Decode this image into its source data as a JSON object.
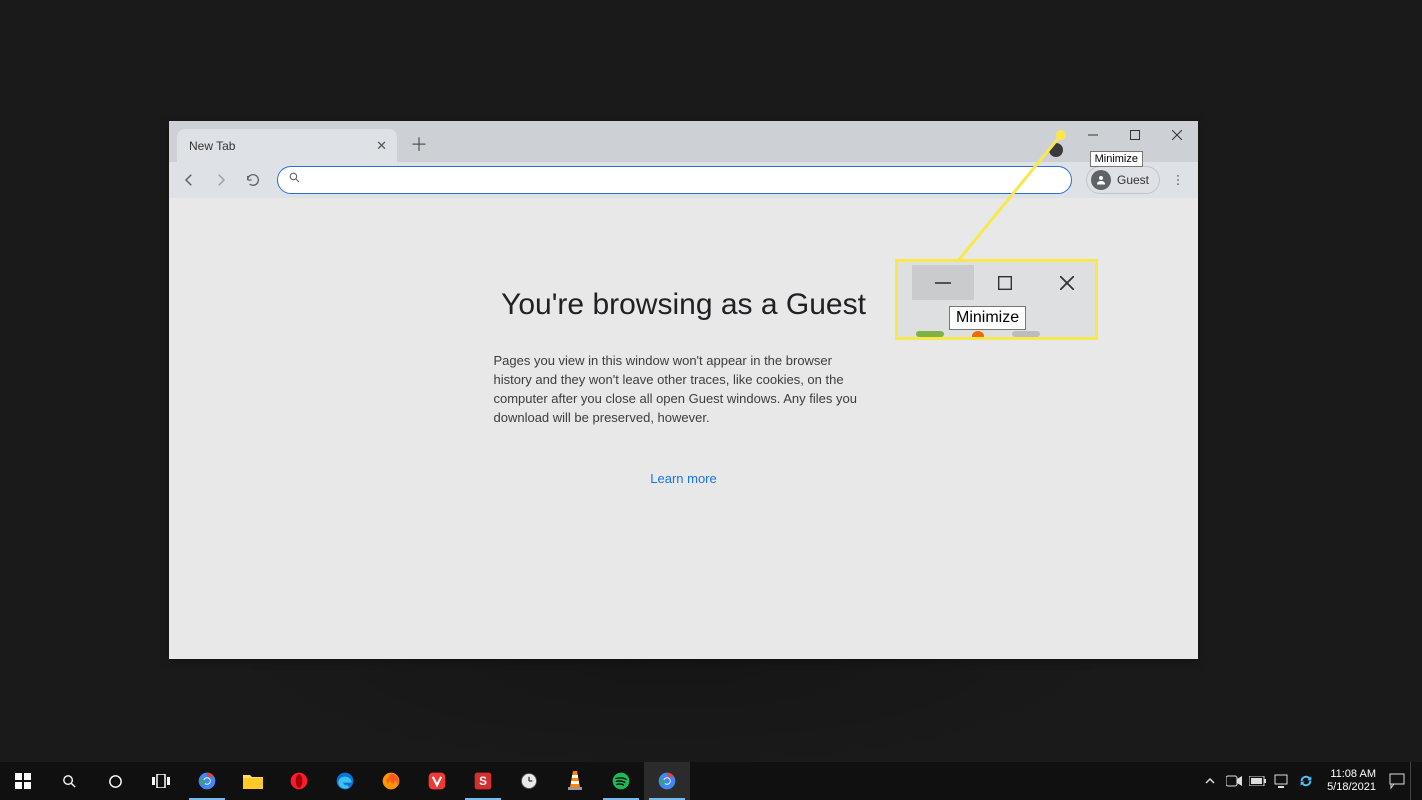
{
  "browser": {
    "tab_title": "New Tab",
    "tooltip": "Minimize",
    "guest_label": "Guest"
  },
  "page": {
    "heading": "You're browsing as a Guest",
    "description": "Pages you view in this window won't appear in the browser history and they won't leave other traces, like cookies, on the computer after you close all open Guest windows. Any files you download will be preserved, however.",
    "learn_more": "Learn more"
  },
  "callout": {
    "tooltip": "Minimize"
  },
  "taskbar": {
    "time": "11:08 AM",
    "date": "5/18/2021"
  }
}
